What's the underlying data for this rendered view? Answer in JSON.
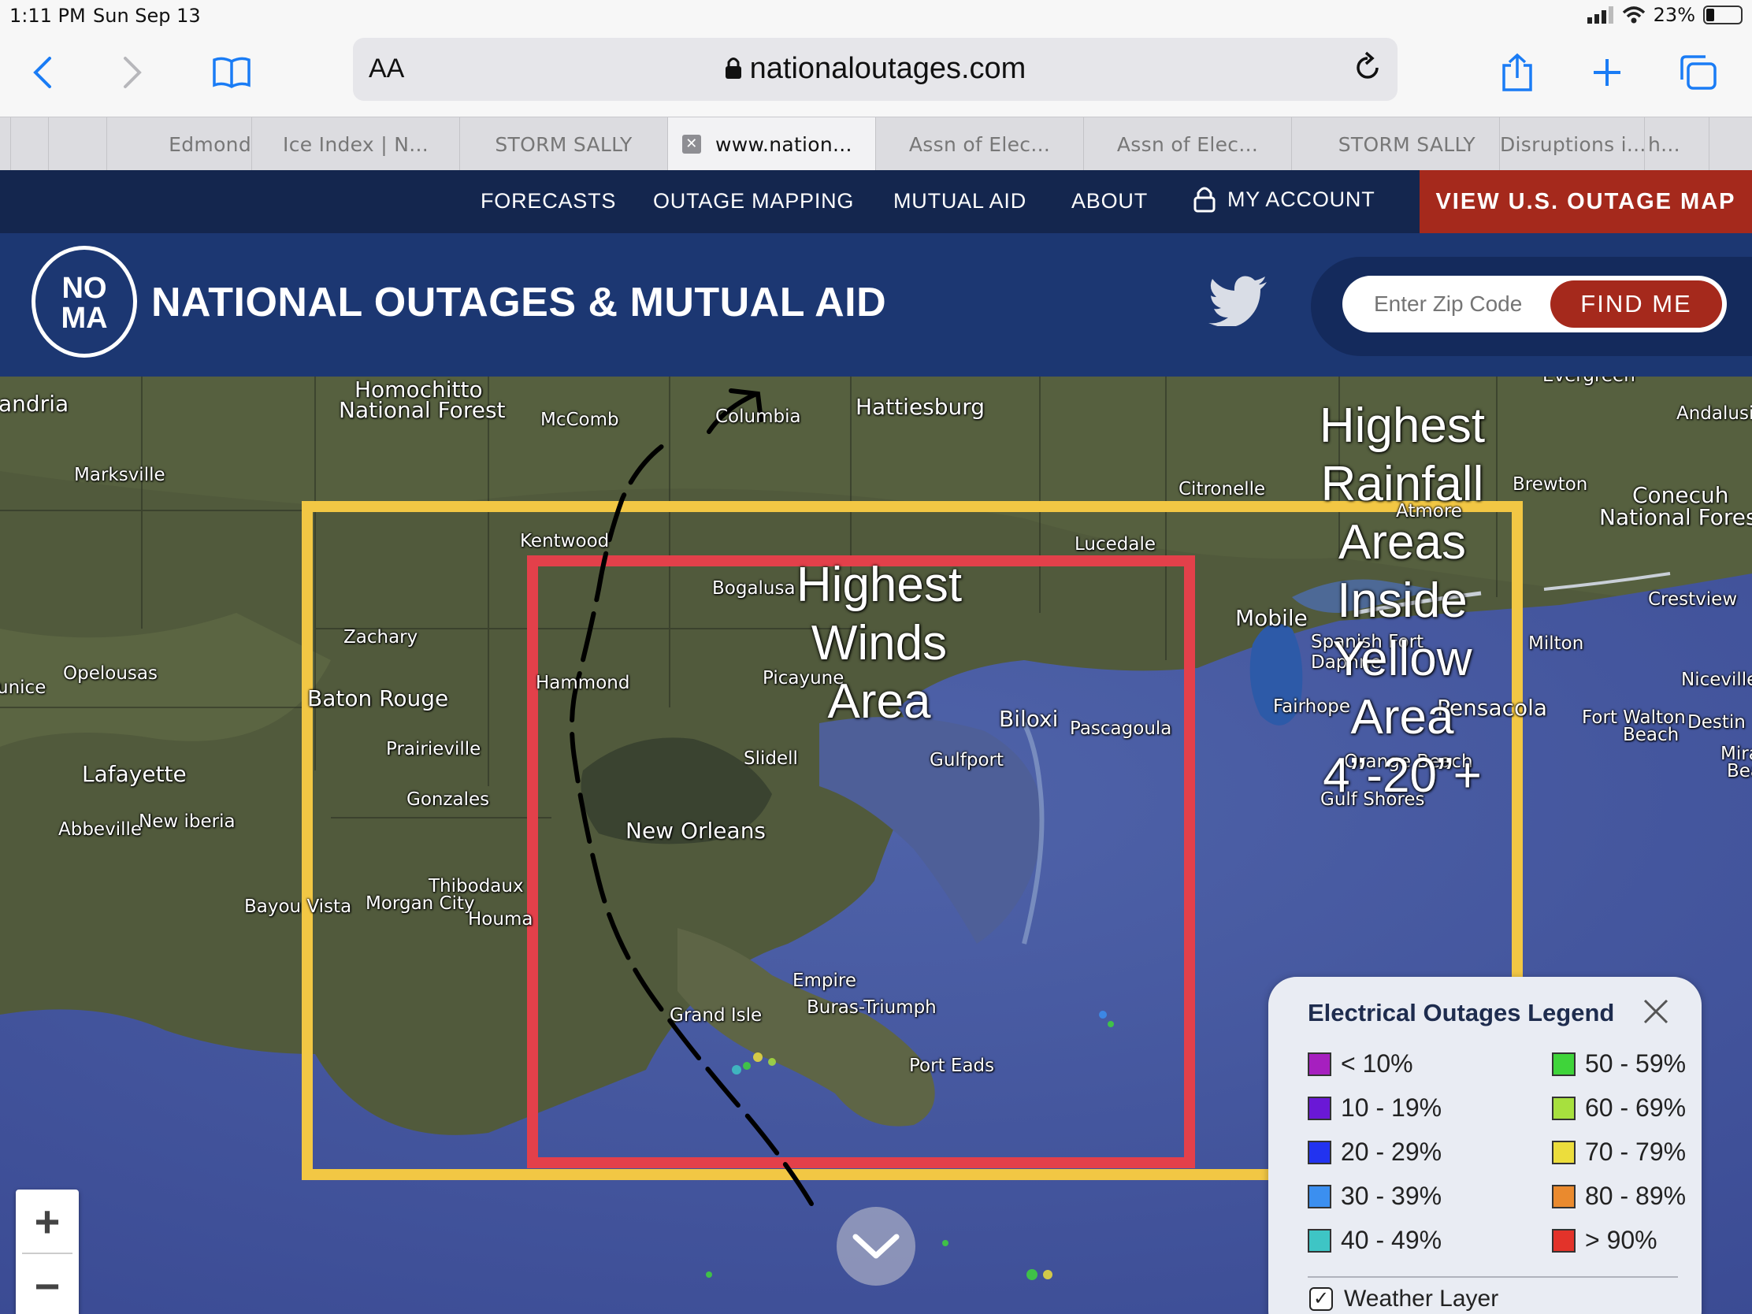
{
  "status_bar": {
    "time": "1:11 PM",
    "date": "Sun Sep 13",
    "battery": "23%",
    "battery_level": 0.23
  },
  "browser": {
    "text_size_label": "AA",
    "url": "nationaloutages.com",
    "tabs": [
      {
        "label": "",
        "active": false
      },
      {
        "label": "",
        "active": false
      },
      {
        "label": "Edmond",
        "active": false
      },
      {
        "label": "Ice Index | N...",
        "active": false
      },
      {
        "label": "STORM SALLY",
        "active": false
      },
      {
        "label": "www.nation...",
        "active": true
      },
      {
        "label": "Assn of Elec...",
        "active": false
      },
      {
        "label": "Assn of Elec...",
        "active": false
      },
      {
        "label": "STORM SALLY",
        "active": false
      },
      {
        "label": "Disruptions i...",
        "active": false
      },
      {
        "label": "h...",
        "active": false
      },
      {
        "label": "",
        "active": false
      }
    ]
  },
  "nav": {
    "links": [
      "FORECASTS",
      "OUTAGE MAPPING",
      "MUTUAL AID",
      "ABOUT",
      "MY ACCOUNT"
    ],
    "cta": "VIEW U.S. OUTAGE MAP"
  },
  "header": {
    "logo_top": "NO",
    "logo_bottom": "MA",
    "site_name": "NATIONAL OUTAGES & MUTUAL AID",
    "zip_placeholder": "Enter Zip Code",
    "find_button": "FIND ME"
  },
  "map": {
    "places": [
      "Homochitto",
      "National Forest",
      "andria",
      "McComb",
      "Columbia",
      "Hattiesburg",
      "Marksville",
      "Citronelle",
      "Brewton",
      "Conecuh",
      "National Forest",
      "Andalusia",
      "Kentwood",
      "Lucedale",
      "Atmore",
      "Bogalusa",
      "Zachary",
      "Mobile",
      "Spanish Fort",
      "Daphne",
      "Crestview",
      "Milton",
      "Opelousas",
      "unice",
      "Baton Rouge",
      "Hammond",
      "Picayune",
      "Fairhope",
      "Pensacola",
      "Niceville",
      "Fort Walton",
      "Beach",
      "Destin",
      "Biloxi",
      "Pascagoula",
      "Prairieville",
      "Slidell",
      "Gulfport",
      "Lafayette",
      "Gonzales",
      "Gulf Shores",
      "Orange Beach",
      "Abbeville",
      "New iberia",
      "New Orleans",
      "Thibodaux",
      "Bayou Vista",
      "Morgan City",
      "Houma",
      "Empire",
      "Buras-Triumph",
      "Grand Isle",
      "Port Eads",
      "Mira",
      "Bea",
      "Evergreen"
    ],
    "annotation_winds": "Highest Winds Area",
    "annotation_rain": "Highest Rainfall Areas Inside Yellow Area 4”-20”+",
    "zoom_in": "+",
    "zoom_out": "−"
  },
  "legend": {
    "title": "Electrical Outages Legend",
    "items": [
      {
        "label": "< 10%",
        "color": "#a61fbf"
      },
      {
        "label": "10 - 19%",
        "color": "#6a18d6"
      },
      {
        "label": "20 - 29%",
        "color": "#2233f0"
      },
      {
        "label": "30 - 39%",
        "color": "#3b8ff0"
      },
      {
        "label": "40 - 49%",
        "color": "#3ec5c5"
      },
      {
        "label": "50 - 59%",
        "color": "#3fd43a"
      },
      {
        "label": "60 - 69%",
        "color": "#a7e03e"
      },
      {
        "label": "70 - 79%",
        "color": "#ecdd3c"
      },
      {
        "label": "80 - 89%",
        "color": "#ea8a2e"
      },
      {
        "label": "> 90%",
        "color": "#e3332a"
      }
    ],
    "weather_layer": "Weather Layer"
  },
  "colors": {
    "nav_bg": "#14264e",
    "header_bg": "#1c3772",
    "accent_red": "#a5291c",
    "yellow_box": "#f2c744",
    "red_box": "#e3404a"
  }
}
